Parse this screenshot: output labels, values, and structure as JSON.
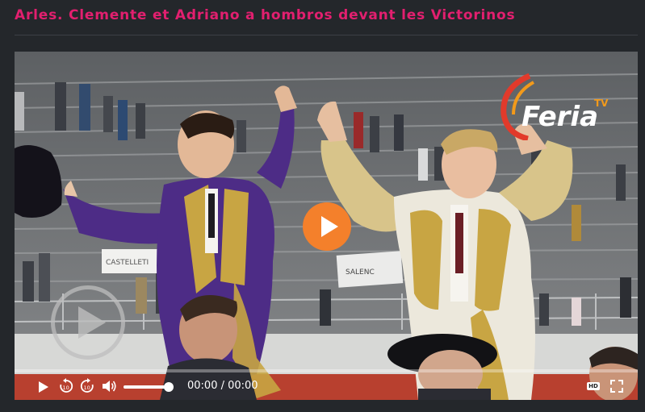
{
  "article": {
    "title": "Arles. Clemente et Adriano a hombros devant les Victorinos"
  },
  "video": {
    "watermark_text": "Feria",
    "watermark_sub": "TV",
    "time_display": "00:00 / 00:00",
    "hd_label": "HD",
    "progress_fraction": 0,
    "volume_fraction": 1,
    "scene_signs": [
      "CASTELLETI",
      "SALENC"
    ]
  },
  "colors": {
    "title": "#e21f6f",
    "page_bg": "#24272b",
    "play_button": "#f4802b",
    "watermark_red": "#e23a2b",
    "watermark_orange": "#f29a1b",
    "costume_purple": "#4d2c86",
    "costume_gold": "#c8a543",
    "costume_ivory": "#ece8dc"
  },
  "icons": {
    "play": "play-icon",
    "rewind": "rewind-10-icon",
    "forward": "forward-10-icon",
    "volume": "volume-icon",
    "hd": "hd-icon",
    "fullscreen": "fullscreen-icon"
  }
}
